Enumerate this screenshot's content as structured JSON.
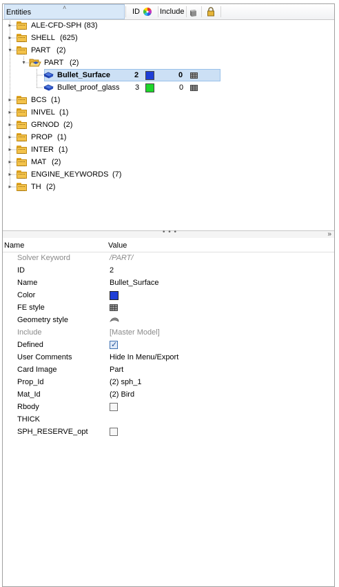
{
  "header": {
    "entities": "Entities",
    "id": "ID",
    "include": "Include",
    "sort_icon": "sort-ascending-icon",
    "color_icon": "color-wheel-icon",
    "fe_icon": "fe-style-icon",
    "lock_icon": "lock-icon"
  },
  "tree": {
    "items": [
      {
        "label": "ALE-CFD-SPH",
        "count": "(83)"
      },
      {
        "label": "SHELL",
        "count": "(625)"
      },
      {
        "label": "PART",
        "count": "(2)"
      },
      {
        "label": "PART",
        "count": "(2)"
      },
      {
        "label": "Bullet_Surface",
        "id": "2",
        "include": "0",
        "color": "#1f3ed6"
      },
      {
        "label": "Bullet_proof_glass",
        "id": "3",
        "include": "0",
        "color": "#1ed62b"
      },
      {
        "label": "BCS",
        "count": "(1)"
      },
      {
        "label": "INIVEL",
        "count": "(1)"
      },
      {
        "label": "GRNOD",
        "count": "(2)"
      },
      {
        "label": "PROP",
        "count": "(1)"
      },
      {
        "label": "INTER",
        "count": "(1)"
      },
      {
        "label": "MAT",
        "count": "(2)"
      },
      {
        "label": "ENGINE_KEYWORDS",
        "count": "(7)"
      },
      {
        "label": "TH",
        "count": "(2)"
      }
    ]
  },
  "splitter": {
    "dots": "• • •",
    "collapse": "»"
  },
  "properties": {
    "name_header": "Name",
    "value_header": "Value",
    "rows": [
      {
        "name": "Solver Keyword",
        "value": "/PART/"
      },
      {
        "name": "ID",
        "value": "2"
      },
      {
        "name": "Name",
        "value": "Bullet_Surface"
      },
      {
        "name": "Color",
        "value": "#1f3ed6"
      },
      {
        "name": "FE style",
        "value": "fe-style-icon"
      },
      {
        "name": "Geometry style",
        "value": "geometry-style-icon"
      },
      {
        "name": "Include",
        "value": "[Master Model]"
      },
      {
        "name": "Defined",
        "value": "checked"
      },
      {
        "name": "User Comments",
        "value": "Hide In Menu/Export"
      },
      {
        "name": "Card Image",
        "value": "Part"
      },
      {
        "name": "Prop_Id",
        "value": "(2) sph_1"
      },
      {
        "name": "Mat_Id",
        "value": "(2) Bird"
      },
      {
        "name": "Rbody",
        "value": "unchecked"
      },
      {
        "name": "THICK",
        "value": ""
      },
      {
        "name": "SPH_RESERVE_opt",
        "value": "unchecked"
      }
    ]
  }
}
